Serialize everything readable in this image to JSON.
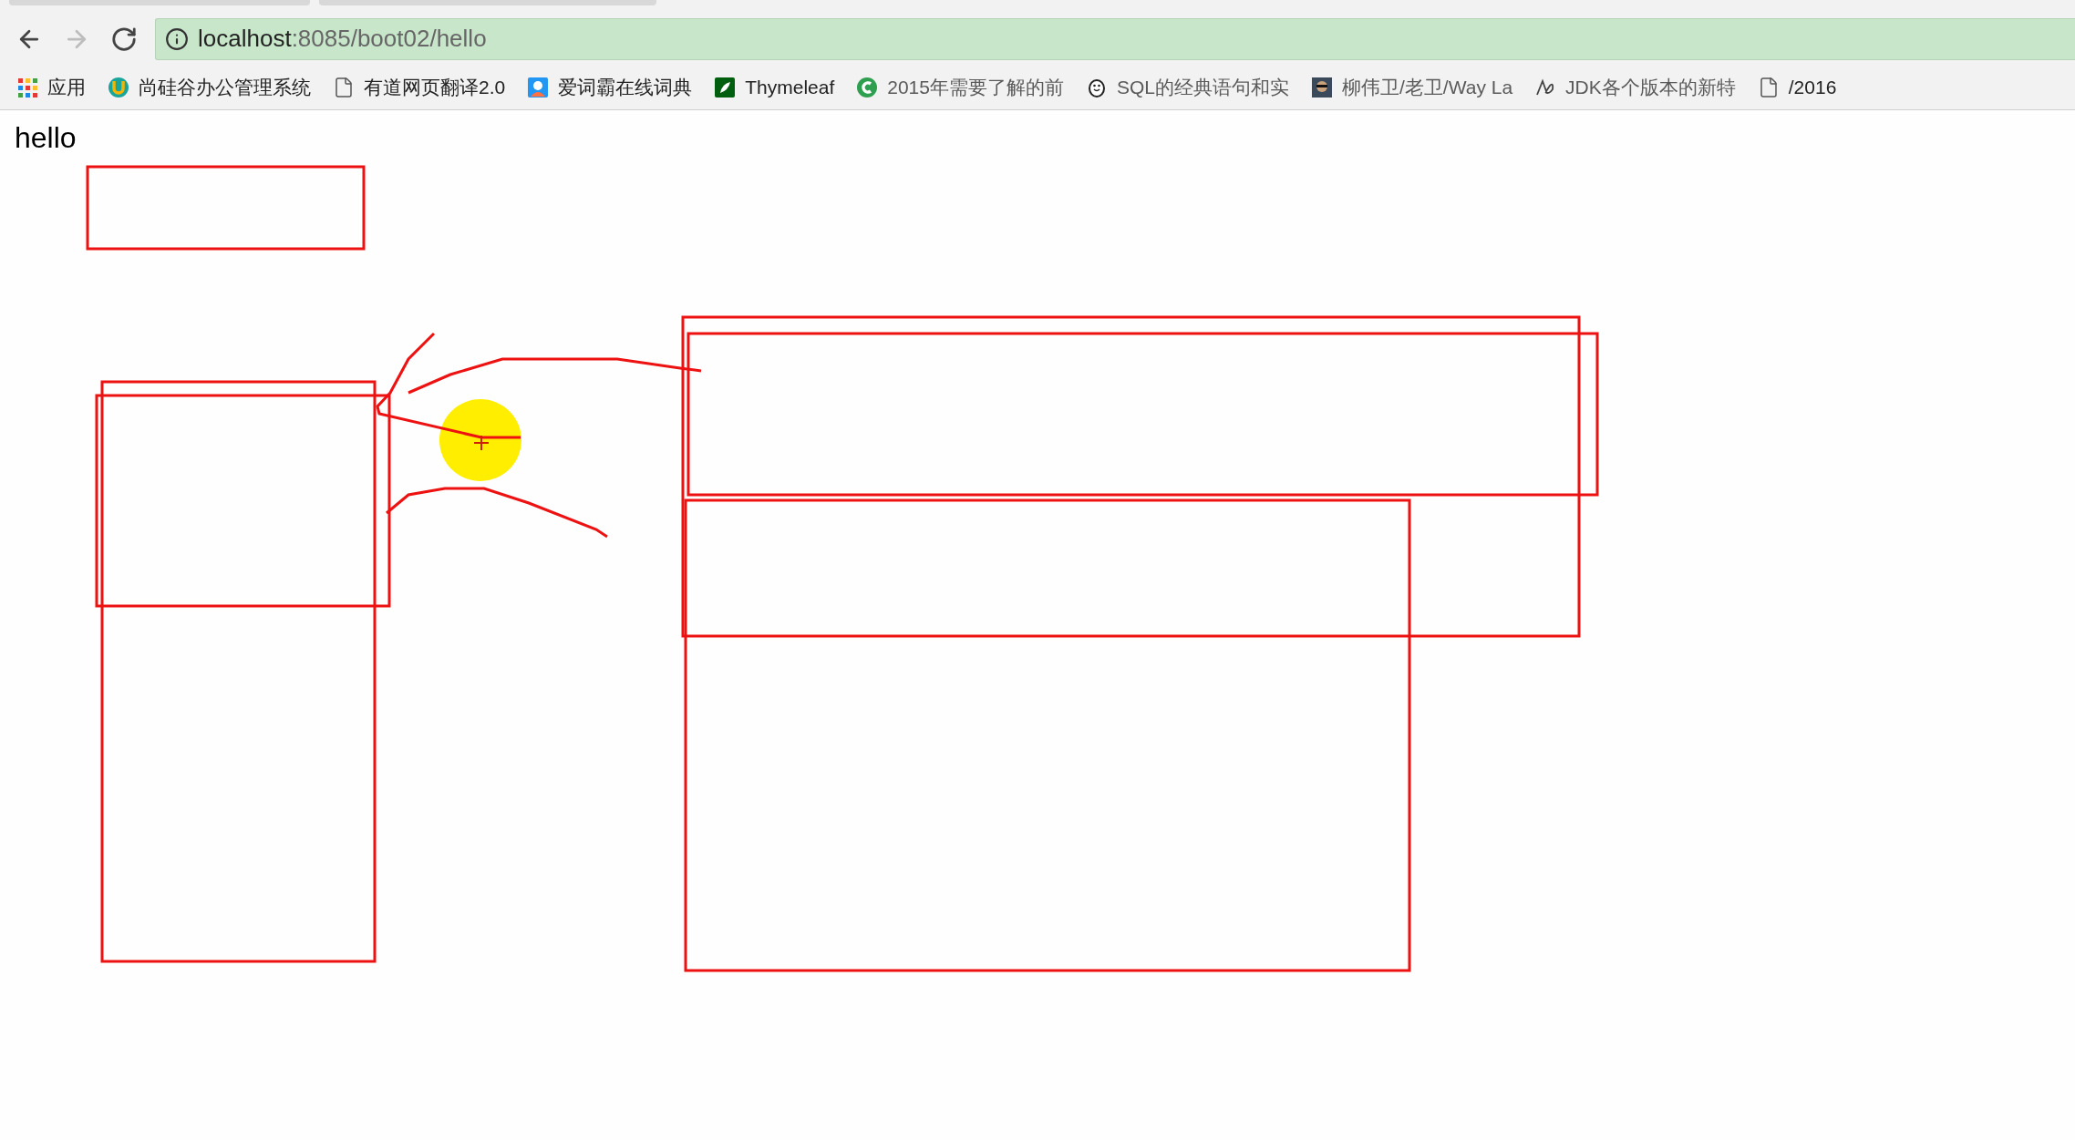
{
  "nav_buttons": [
    {
      "disabled": false
    },
    {
      "disabled": true
    },
    {
      "disabled": false
    }
  ],
  "address_bar": {
    "host": "localhost",
    "path": ":8085/boot02/hello"
  },
  "bookmarks": [
    {
      "label": "应用",
      "faded": false
    },
    {
      "label": "尚硅谷办公管理系统",
      "faded": false
    },
    {
      "label": "有道网页翻译2.0",
      "faded": false
    },
    {
      "label": "爱词霸在线词典",
      "faded": false
    },
    {
      "label": "Thymeleaf",
      "faded": false
    },
    {
      "label": "2015年需要了解的前",
      "faded": true
    },
    {
      "label": "SQL的经典语句和实",
      "faded": true
    },
    {
      "label": "柳伟卫/老卫/Way La",
      "faded": true
    },
    {
      "label": "JDK各个版本的新特",
      "faded": true
    },
    {
      "label": "/2016",
      "faded": false
    }
  ],
  "page": {
    "heading": "hello"
  }
}
